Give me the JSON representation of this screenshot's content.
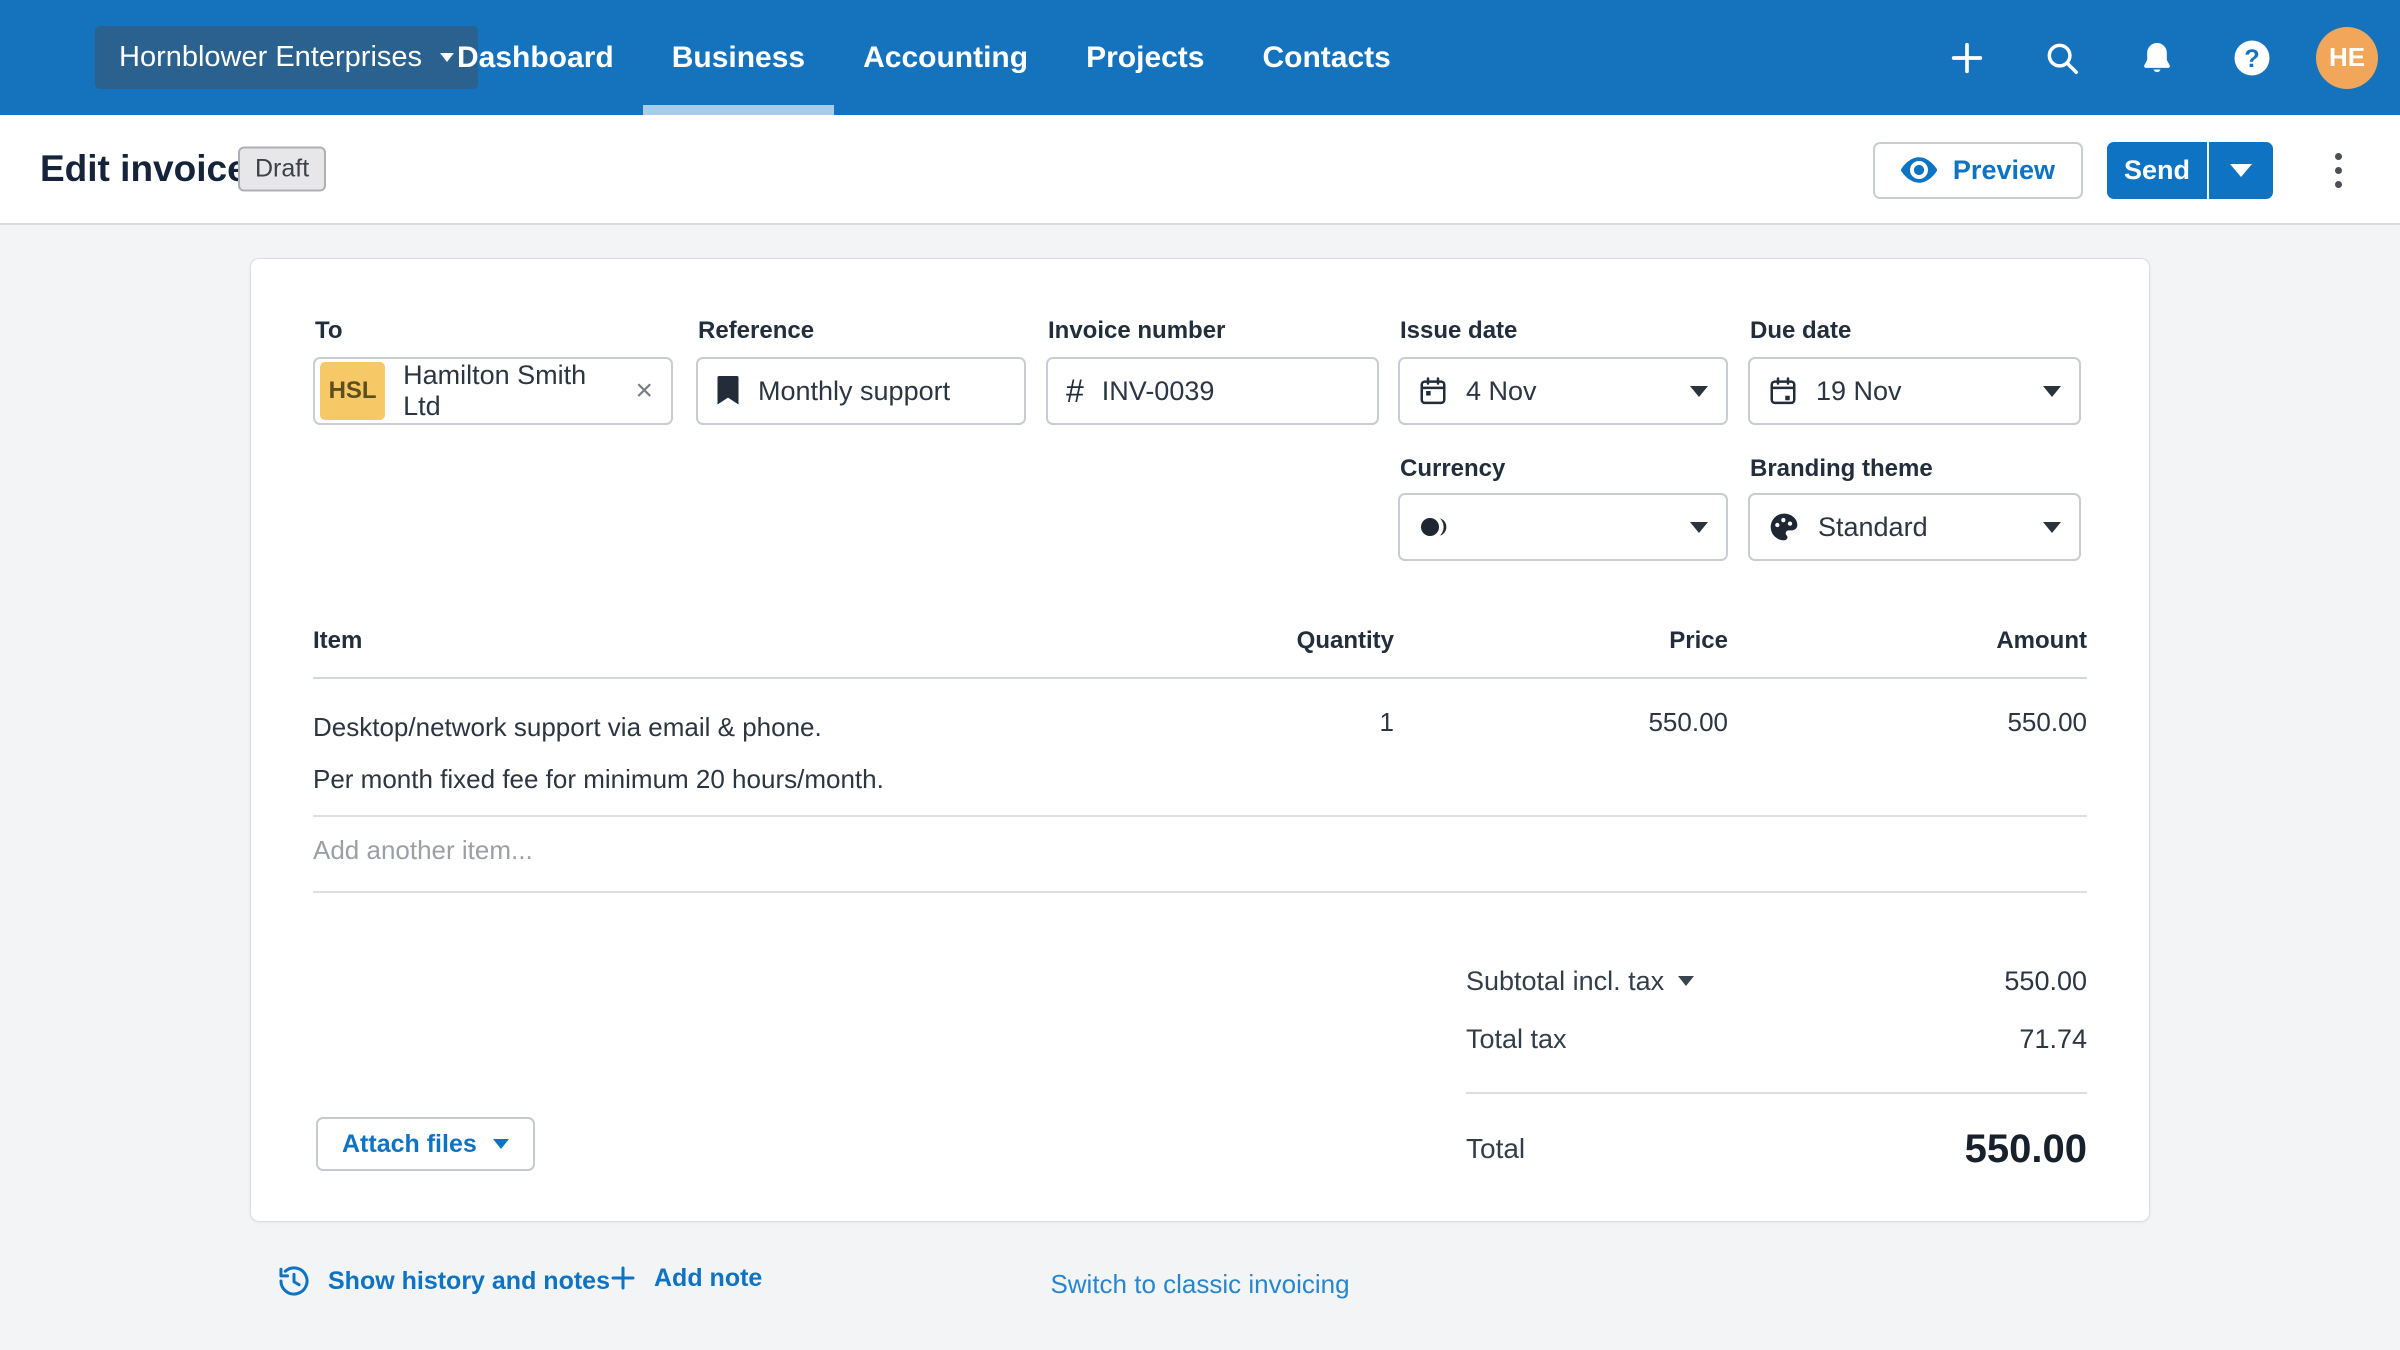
{
  "nav": {
    "org": "Hornblower Enterprises",
    "items": [
      "Dashboard",
      "Business",
      "Accounting",
      "Projects",
      "Contacts"
    ],
    "active": "Business",
    "avatar_initials": "HE"
  },
  "header": {
    "title": "Edit invoice",
    "status": "Draft",
    "preview_label": "Preview",
    "send_label": "Send"
  },
  "fields": {
    "to": {
      "label": "To",
      "badge": "HSL",
      "value": "Hamilton Smith Ltd"
    },
    "reference": {
      "label": "Reference",
      "value": "Monthly support"
    },
    "invoice_number": {
      "label": "Invoice number",
      "prefix": "#",
      "value": "INV-0039"
    },
    "issue_date": {
      "label": "Issue date",
      "value": "4 Nov"
    },
    "due_date": {
      "label": "Due date",
      "value": "19 Nov"
    },
    "currency": {
      "label": "Currency",
      "value": ""
    },
    "branding_theme": {
      "label": "Branding theme",
      "value": "Standard"
    }
  },
  "table": {
    "headers": [
      "Item",
      "Quantity",
      "Price",
      "Amount"
    ],
    "rows": [
      {
        "item_line1": "Desktop/network support via email & phone.",
        "item_line2": "Per month fixed fee for minimum 20 hours/month.",
        "quantity": "1",
        "price": "550.00",
        "amount": "550.00"
      }
    ],
    "add_placeholder": "Add another item..."
  },
  "totals": {
    "subtotal_label": "Subtotal incl. tax",
    "subtotal_value": "550.00",
    "tax_label": "Total tax",
    "tax_value": "71.74",
    "total_label": "Total",
    "total_value": "550.00"
  },
  "actions": {
    "attach_label": "Attach files",
    "history_label": "Show history and notes",
    "add_note_label": "Add note",
    "switch_label": "Switch to classic invoicing"
  },
  "colors": {
    "nav_blue": "#1573BE",
    "org_button_blue": "#2B618F",
    "active_tab_underline": "#A8CCEA",
    "accent_blue": "#0D73C2",
    "avatar_orange": "#F2A65A",
    "contact_chip_amber": "#F6C966",
    "page_background": "#F3F4F6"
  }
}
